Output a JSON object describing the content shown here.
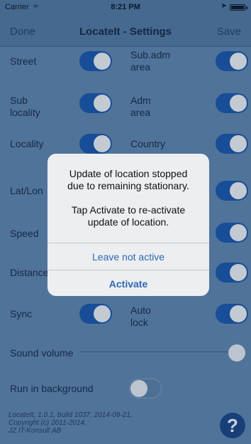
{
  "status_bar": {
    "carrier": "Carrier",
    "wifi_icon": "wifi-icon",
    "time": "8:21 PM",
    "location_icon": "location-arrow-icon",
    "battery_icon": "battery-icon"
  },
  "nav": {
    "done": "Done",
    "title": "LocateIt - Settings",
    "save": "Save"
  },
  "settings": {
    "street": {
      "label": "Street",
      "on": true
    },
    "sub_adm_area": {
      "label_line1": "Sub.adm",
      "label_line2": "area",
      "on": true
    },
    "sub_locality": {
      "label_line1": "Sub",
      "label_line2": "locality",
      "on": true
    },
    "adm_area": {
      "label_line1": "Adm",
      "label_line2": "area",
      "on": true
    },
    "locality": {
      "label": "Locality",
      "on": true
    },
    "country": {
      "label": "Country",
      "on": true
    },
    "lat_lon": {
      "label": "Lat/Lon",
      "on": true
    },
    "speed": {
      "label": "Speed",
      "on": true
    },
    "distance": {
      "label": "Distance",
      "on": true
    },
    "sync": {
      "label": "Sync",
      "on": true
    },
    "auto_lock": {
      "label_line1": "Auto",
      "label_line2": "lock",
      "on": true
    },
    "sound_volume": {
      "label": "Sound volume",
      "level": 1.0
    },
    "run_in_background": {
      "label": "Run in background",
      "on": false
    }
  },
  "footer": {
    "line1": "LocateIt, 1.0.1, build 1037, 2014-09-21,",
    "line2": "Copyright (c) 2011-2014,",
    "line3": "JZ IT-Konsult AB",
    "help_icon": "help-question-icon",
    "help_glyph": "?"
  },
  "alert": {
    "message_line1": "Update of location stopped",
    "message_line2": "due to remaining stationary.",
    "message_line3": "Tap Activate to re-activate",
    "message_line4": "update of location.",
    "leave_button": "Leave not active",
    "activate_button": "Activate"
  },
  "colors": {
    "background": "#50739a",
    "nav_bar": "#45698f",
    "toggle_on": "#184d97",
    "alert_button": "#2f68b4"
  }
}
